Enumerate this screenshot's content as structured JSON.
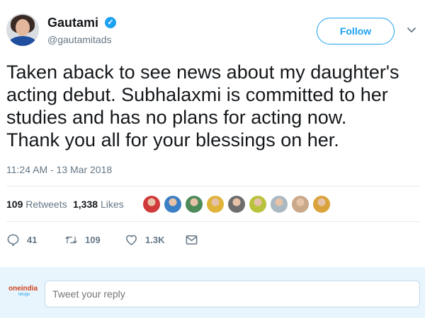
{
  "user": {
    "name": "Gautami",
    "handle": "@gautamitads",
    "verified_mark": "✓"
  },
  "follow_label": "Follow",
  "tweet": {
    "text_lines": [
      "Taken aback to see news about my daughter's",
      "acting debut. Subhalaxmi is committed to her",
      "studies and has no plans for acting now.",
      "Thank you all for your blessings on her."
    ],
    "timestamp": "11:24 AM - 13 Mar 2018"
  },
  "stats": {
    "retweets_count": "109",
    "retweets_label": "Retweets",
    "likes_count": "1,338",
    "likes_label": "Likes"
  },
  "likers": [
    {
      "name": "liker-1-avatar",
      "color": "#d13a3a"
    },
    {
      "name": "liker-2-avatar",
      "color": "#3b7fc4"
    },
    {
      "name": "liker-3-avatar",
      "color": "#4c8a5a"
    },
    {
      "name": "liker-4-avatar",
      "color": "#e0b43a"
    },
    {
      "name": "liker-5-avatar",
      "color": "#6d6d6d"
    },
    {
      "name": "liker-6-avatar",
      "color": "#b8c23a"
    },
    {
      "name": "liker-7-avatar",
      "color": "#aab8c2"
    },
    {
      "name": "liker-8-avatar",
      "color": "#c9a98a"
    },
    {
      "name": "liker-9-avatar",
      "color": "#d9a23a"
    }
  ],
  "actions": {
    "reply_count": "41",
    "retweet_count": "109",
    "like_count": "1.3K"
  },
  "reply": {
    "placeholder": "Tweet your reply",
    "brand_top": "oneindia",
    "brand_bottom": "telugu"
  },
  "colors": {
    "accent": "#1da1f2",
    "muted": "#657786",
    "reply_bar": "#e8f5fd"
  }
}
